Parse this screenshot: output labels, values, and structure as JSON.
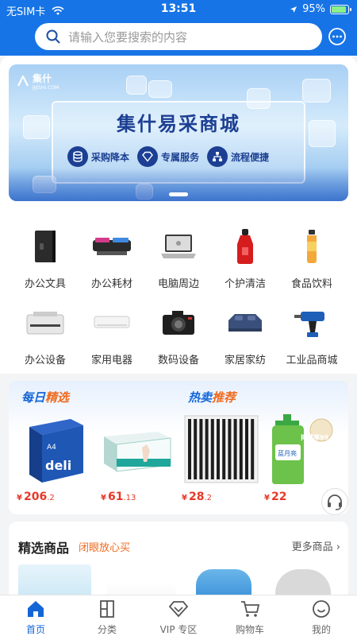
{
  "status": {
    "carrier": "无SIM卡",
    "time": "13:51",
    "battery": "95%",
    "battery_level": 0.95
  },
  "search": {
    "placeholder": "请输入您要搜索的内容"
  },
  "banner": {
    "logo": "集什",
    "logo_sub": "JIJISHI.COM",
    "title": "集什易采商城",
    "features": [
      "采购降本",
      "专属服务",
      "流程便捷"
    ]
  },
  "categories": [
    {
      "label": "办公文具",
      "icon": "folder-icon"
    },
    {
      "label": "办公耗材",
      "icon": "toner-icon"
    },
    {
      "label": "电脑周边",
      "icon": "laptop-icon"
    },
    {
      "label": "个护清洁",
      "icon": "bottle-icon"
    },
    {
      "label": "食品饮料",
      "icon": "drink-icon"
    },
    {
      "label": "办公设备",
      "icon": "printer-icon"
    },
    {
      "label": "家用电器",
      "icon": "air-conditioner-icon"
    },
    {
      "label": "数码设备",
      "icon": "camera-icon"
    },
    {
      "label": "家居家纺",
      "icon": "bed-icon"
    },
    {
      "label": "工业品商城",
      "icon": "drill-icon"
    }
  ],
  "picks": {
    "daily_tag_a": "每日",
    "daily_tag_b": "精选",
    "hot_tag_a": "热卖",
    "hot_tag_b": "推荐",
    "currency": "¥",
    "products": [
      {
        "name": "A4 paper",
        "price_int": "206",
        "price_dec": ".2"
      },
      {
        "name": "gloves",
        "price_int": "61",
        "price_dec": ".13"
      },
      {
        "name": "pens",
        "price_int": "28",
        "price_dec": ".2"
      },
      {
        "name": "hand wash",
        "price_int": "22",
        "price_dec": ""
      }
    ],
    "paper_brand": "deli",
    "handwash_badge": "抑菌率99.9%",
    "handwash_brand": "蓝月亮"
  },
  "featured": {
    "title": "精选商品",
    "subtitle": "闭眼放心买",
    "more": "更多商品"
  },
  "tabs": [
    {
      "label": "首页",
      "active": true
    },
    {
      "label": "分类",
      "active": false
    },
    {
      "label": "VIP 专区",
      "active": false
    },
    {
      "label": "购物车",
      "active": false
    },
    {
      "label": "我的",
      "active": false
    }
  ],
  "colors": {
    "brand": "#1774e6",
    "price": "#e73827",
    "accent": "#f06a1e",
    "tab_active": "#1466d6"
  }
}
